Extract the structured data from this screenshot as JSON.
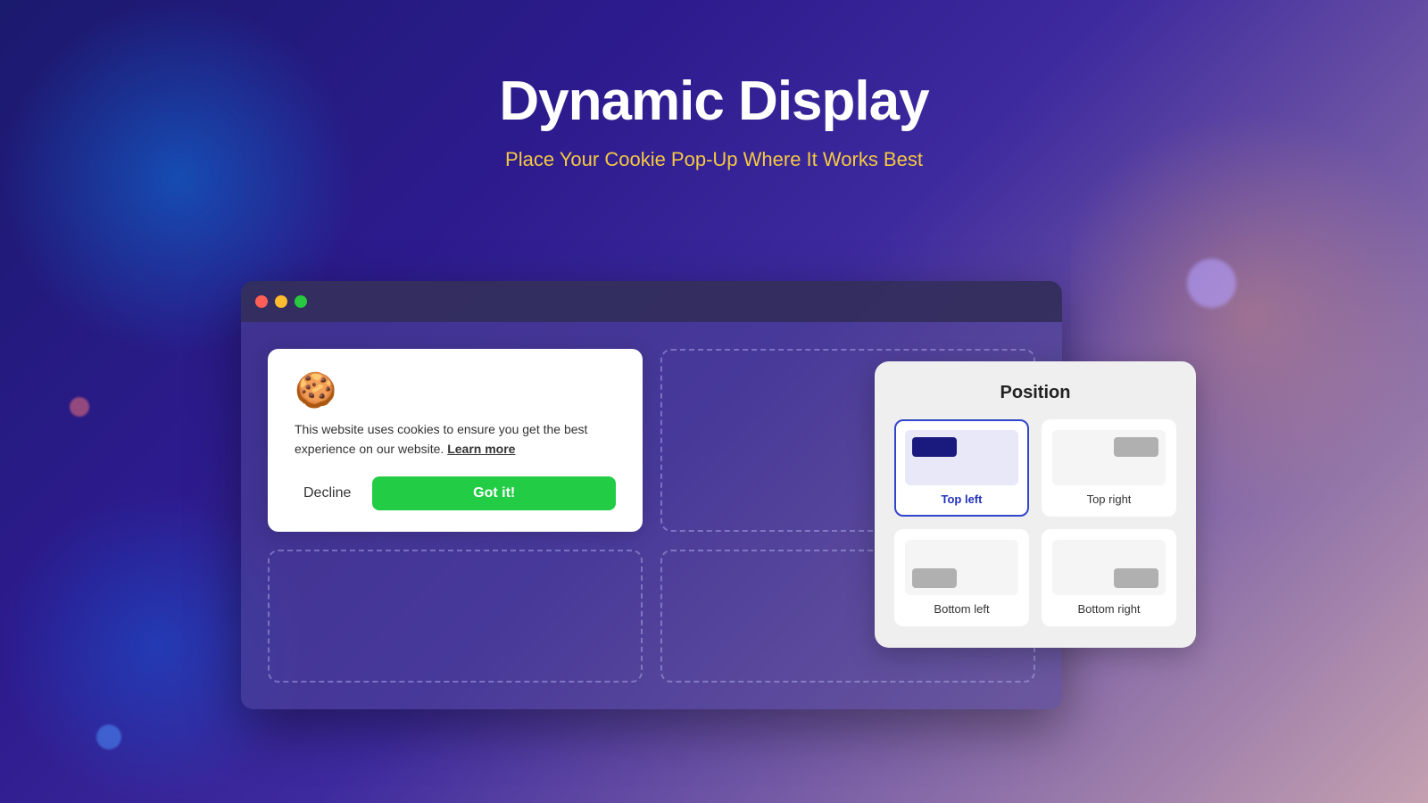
{
  "page": {
    "title": "Dynamic Display",
    "subtitle": "Place Your Cookie Pop-Up Where It Works Best"
  },
  "browser": {
    "traffic_lights": [
      "red",
      "yellow",
      "green"
    ]
  },
  "cookie_popup": {
    "icon": "🍪",
    "text": "This website uses cookies to ensure you get the best experience on our website.",
    "learn_more": "Learn more",
    "decline_label": "Decline",
    "got_it_label": "Got it!"
  },
  "position_panel": {
    "title": "Position",
    "options": [
      {
        "id": "top-left",
        "label": "Top left",
        "selected": true
      },
      {
        "id": "top-right",
        "label": "Top right",
        "selected": false
      },
      {
        "id": "bottom-left",
        "label": "Bottom left",
        "selected": false
      },
      {
        "id": "bottom-right",
        "label": "Bottom right",
        "selected": false
      }
    ]
  }
}
